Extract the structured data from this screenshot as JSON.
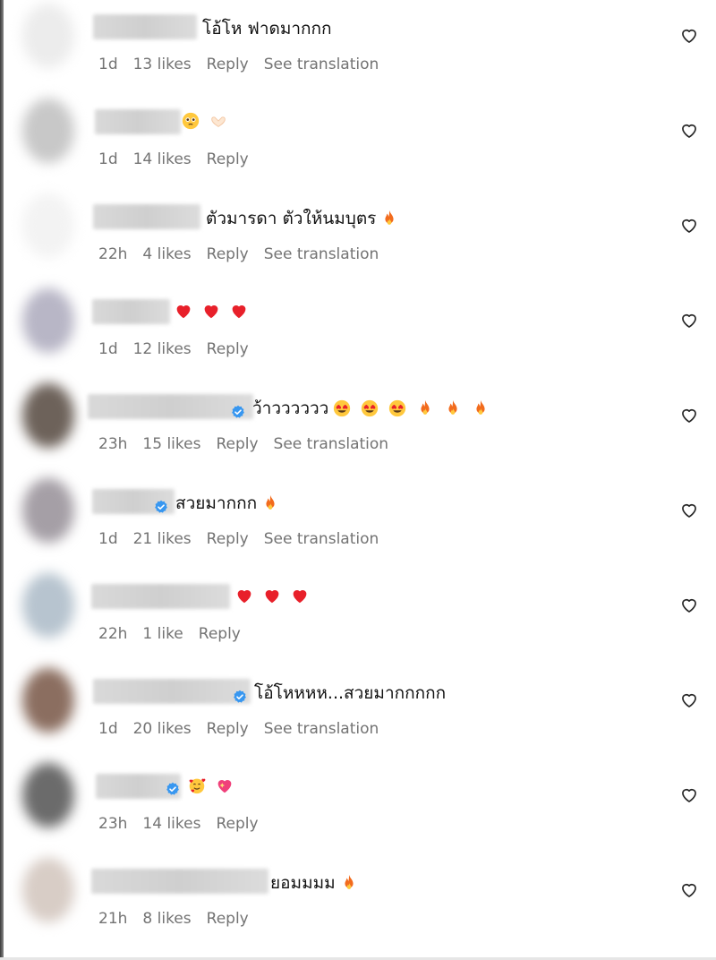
{
  "comments": [
    {
      "time": "1d",
      "likes": "13 likes",
      "reply": "Reply",
      "translate": "See translation",
      "text": "โอ้โห ฟาดมากกก",
      "verified": false,
      "emojis": [],
      "avatar_color": "#ececec"
    },
    {
      "time": "1d",
      "likes": "14 likes",
      "reply": "Reply",
      "translate": "",
      "text": "",
      "verified": false,
      "emojis": [
        "face-holding-back-tears",
        "heart-hands"
      ],
      "avatar_color": "#c8c8c8"
    },
    {
      "time": "22h",
      "likes": "4 likes",
      "reply": "Reply",
      "translate": "See translation",
      "text": "ตัวมารดา ตัวให้นมบุตร",
      "verified": false,
      "emojis": [
        "fire"
      ],
      "avatar_color": "#f3f3f3"
    },
    {
      "time": "1d",
      "likes": "12 likes",
      "reply": "Reply",
      "translate": "",
      "text": "",
      "verified": false,
      "emojis": [
        "red-heart",
        "red-heart",
        "red-heart"
      ],
      "avatar_color": "#b8b6c6"
    },
    {
      "time": "23h",
      "likes": "15 likes",
      "reply": "Reply",
      "translate": "See translation",
      "text": "ว้าวววววว",
      "verified": true,
      "emojis": [
        "heart-eyes",
        "heart-eyes",
        "heart-eyes",
        "fire",
        "fire",
        "fire"
      ],
      "avatar_color": "#6d625a"
    },
    {
      "time": "1d",
      "likes": "21 likes",
      "reply": "Reply",
      "translate": "See translation",
      "text": "สวยมากกก",
      "verified": true,
      "emojis": [
        "fire"
      ],
      "avatar_color": "#a59fa6"
    },
    {
      "time": "22h",
      "likes": "1 like",
      "reply": "Reply",
      "translate": "",
      "text": "",
      "verified": false,
      "emojis": [
        "red-heart",
        "red-heart",
        "red-heart"
      ],
      "avatar_color": "#b7c4cf"
    },
    {
      "time": "1d",
      "likes": "20 likes",
      "reply": "Reply",
      "translate": "See translation",
      "text": "โอ้โหหหห...สวยมากกกกก",
      "verified": true,
      "emojis": [],
      "avatar_color": "#8b6e60"
    },
    {
      "time": "23h",
      "likes": "14 likes",
      "reply": "Reply",
      "translate": "",
      "text": "",
      "verified": true,
      "emojis": [
        "smiling-face-with-hearts",
        "sparkling-heart"
      ],
      "avatar_color": "#6b6b6b"
    },
    {
      "time": "21h",
      "likes": "8 likes",
      "reply": "Reply",
      "translate": "",
      "text": "ยอมมมม",
      "verified": false,
      "emojis": [
        "fire"
      ],
      "avatar_color": "#d8cdc6"
    }
  ],
  "colors": {
    "text": "#111111",
    "meta": "#737373",
    "verified": "#3897f0",
    "heart_emoji": "#e8202a",
    "fire": "#f26b1d"
  },
  "icons": {
    "like": "heart-outline-icon",
    "verified": "verified-badge-icon"
  }
}
